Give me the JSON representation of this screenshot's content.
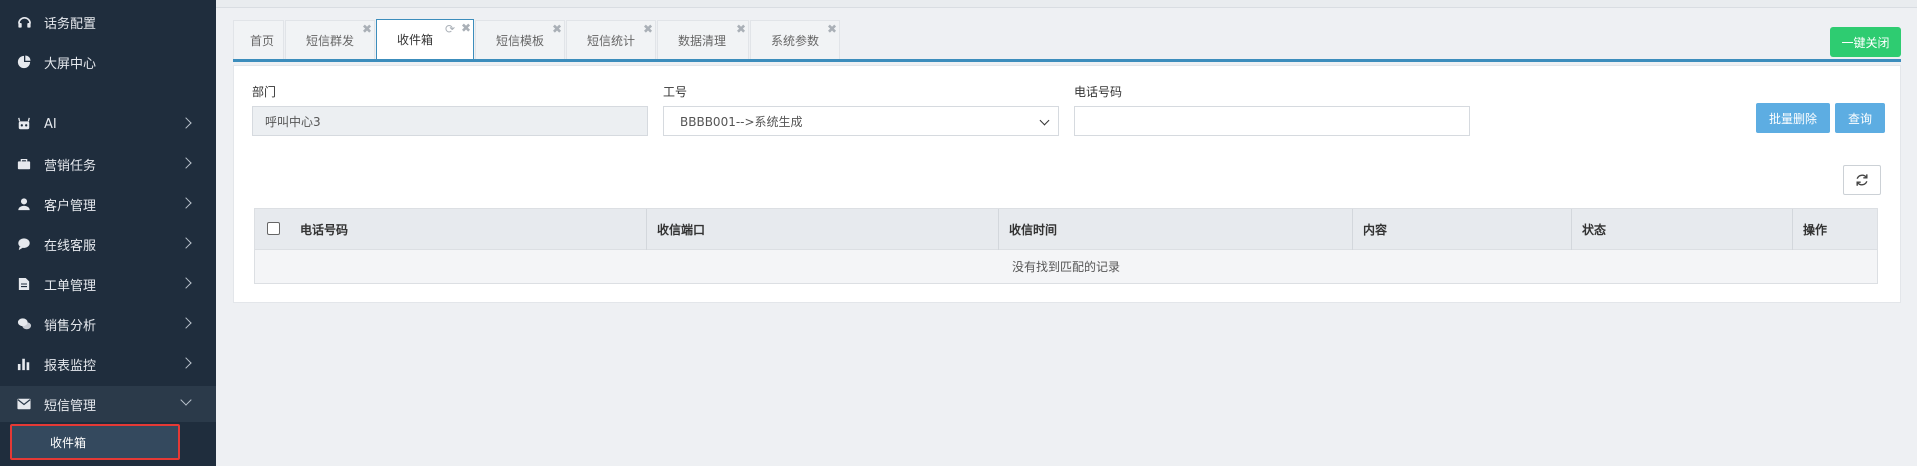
{
  "sidebar": {
    "items": [
      {
        "label": "话务配置",
        "icon": "headset-icon"
      },
      {
        "label": "大屏中心",
        "icon": "pie-chart-icon"
      },
      {
        "label": "AI",
        "icon": "robot-icon"
      },
      {
        "label": "营销任务",
        "icon": "briefcase-icon"
      },
      {
        "label": "客户管理",
        "icon": "user-icon"
      },
      {
        "label": "在线客服",
        "icon": "chat-bubble-icon"
      },
      {
        "label": "工单管理",
        "icon": "document-icon"
      },
      {
        "label": "销售分析",
        "icon": "comments-icon"
      },
      {
        "label": "报表监控",
        "icon": "bar-chart-icon"
      },
      {
        "label": "短信管理",
        "icon": "envelope-icon"
      }
    ],
    "sub_active": "收件箱"
  },
  "tabs": [
    {
      "label": "首页"
    },
    {
      "label": "短信群发"
    },
    {
      "label": "收件箱"
    },
    {
      "label": "短信模板"
    },
    {
      "label": "短信统计"
    },
    {
      "label": "数据清理"
    },
    {
      "label": "系统参数"
    }
  ],
  "close_all_label": "一键关闭",
  "filters": {
    "dept_label": "部门",
    "dept_value": "呼叫中心3",
    "job_label": "工号",
    "job_value": "BBBB001-->系统生成",
    "phone_label": "电话号码",
    "phone_value": ""
  },
  "buttons": {
    "batch_delete": "批量删除",
    "query": "查询"
  },
  "table": {
    "columns": [
      "电话号码",
      "收信端口",
      "收信时间",
      "内容",
      "状态",
      "操作"
    ],
    "empty_text": "没有找到匹配的记录"
  },
  "colors": {
    "sidebar_bg": "#1f2d3d",
    "accent": "#3c8dbc",
    "green": "#2ecc71",
    "button_blue": "#5dade2",
    "highlight_border": "#e53935"
  }
}
